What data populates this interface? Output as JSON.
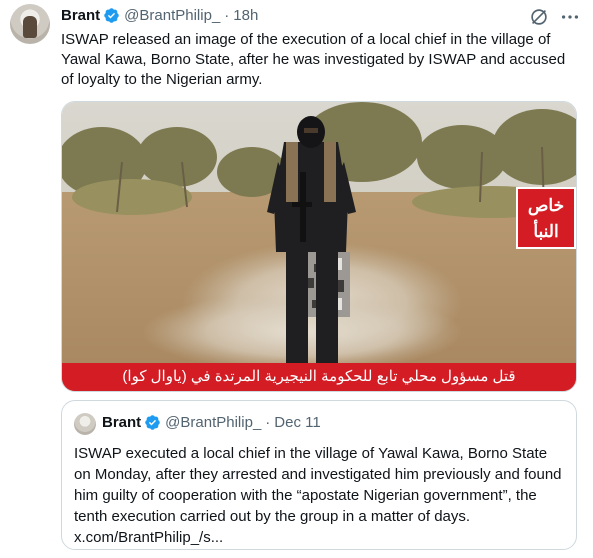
{
  "tweet": {
    "name": "Brant",
    "handle": "@BrantPhilip_",
    "separator": "·",
    "time": "18h",
    "text": "ISWAP released an image of the execution of a local chief in the village of Yawal Kawa, Borno State, after he was investigated by ISWAP and accused of loyalty to the Nigerian army.",
    "icons": [
      "grok-icon",
      "more-icon"
    ]
  },
  "media": {
    "logo_text": "خاص النبأ",
    "caption": "قتل مسؤول محلي تابع للحكومة النيجيرية المرتدة في (ياوال كوا)"
  },
  "quote": {
    "name": "Brant",
    "handle": "@BrantPhilip_",
    "separator": "·",
    "time": "Dec 11",
    "text": "ISWAP executed a local chief in the village of Yawal Kawa, Borno State on Monday, after they arrested and investigated him previously and found him guilty of cooperation with the “apostate Nigerian government”, the tenth execution carried out by the group in a matter of days. x.com/BrantPhilip_/s..."
  },
  "colors": {
    "text": "#0f1419",
    "secondary": "#536471",
    "verified": "#1d9bf0",
    "border": "#cfd9de",
    "banner_red": "#d31c24"
  }
}
